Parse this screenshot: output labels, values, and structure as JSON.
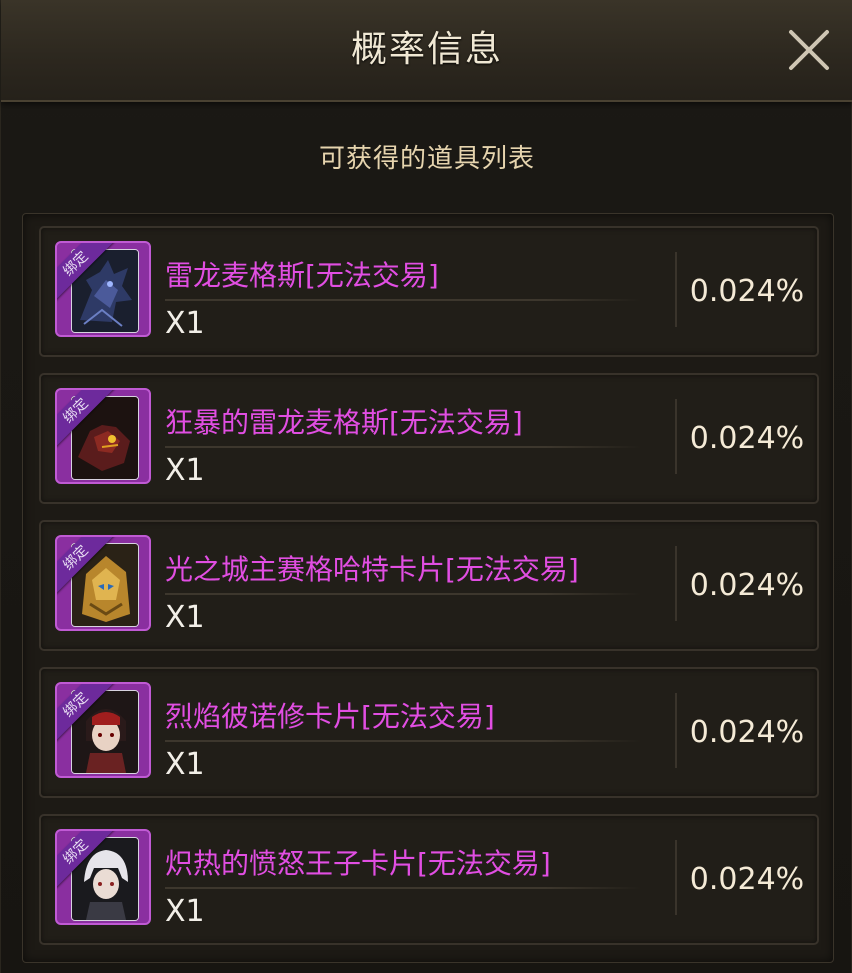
{
  "dialog": {
    "title": "概率信息",
    "close_icon": "close-icon",
    "subtitle": "可获得的道具列表"
  },
  "items": [
    {
      "name": "雷龙麦格斯[无法交易]",
      "qty": "X1",
      "rate": "0.024%",
      "badge": "绑定",
      "icon": "thunder-dragon-card-icon"
    },
    {
      "name": "狂暴的雷龙麦格斯[无法交易]",
      "qty": "X1",
      "rate": "0.024%",
      "badge": "绑定",
      "icon": "berserk-dragon-card-icon"
    },
    {
      "name": "光之城主赛格哈特卡片[无法交易]",
      "qty": "X1",
      "rate": "0.024%",
      "badge": "绑定",
      "icon": "golden-mask-card-icon"
    },
    {
      "name": "烈焰彼诺修卡片[无法交易]",
      "qty": "X1",
      "rate": "0.024%",
      "badge": "绑定",
      "icon": "flame-character-card-icon"
    },
    {
      "name": "炽热的愤怒王子卡片[无法交易]",
      "qty": "X1",
      "rate": "0.024%",
      "badge": "绑定",
      "icon": "white-hair-character-card-icon"
    }
  ],
  "colors": {
    "item_name": "#e14ee2",
    "rarity_frame": "#8a2fa0",
    "rate_text": "#f4ead6",
    "title_text": "#f0e8d4",
    "subtitle_text": "#e6d4ae"
  }
}
